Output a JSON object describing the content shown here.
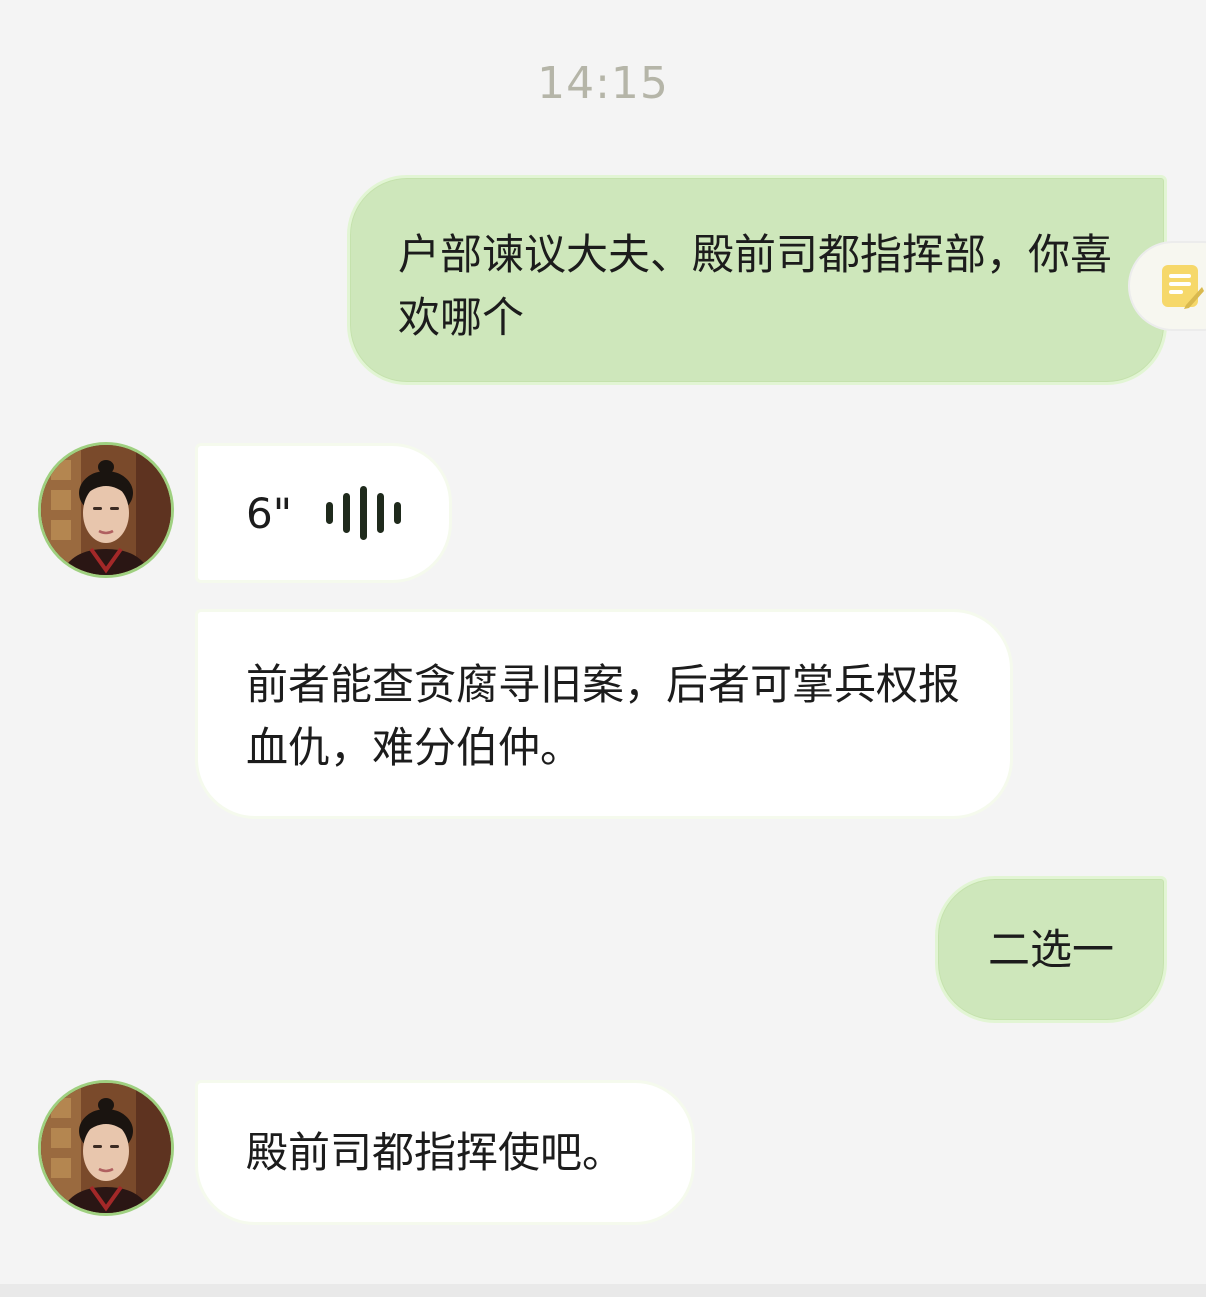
{
  "chat": {
    "timestamp": "14:15",
    "messages": [
      {
        "direction": "outgoing",
        "type": "text",
        "text": "户部谏议大夫、殿前司都指挥部，你喜欢哪个"
      },
      {
        "direction": "incoming",
        "type": "voice",
        "duration": "6\"",
        "icon": "sound-wave-icon"
      },
      {
        "direction": "incoming",
        "type": "text",
        "text": "前者能查贪腐寻旧案，后者可掌兵权报血仇，难分伯仲。"
      },
      {
        "direction": "outgoing",
        "type": "text",
        "text": "二选一"
      },
      {
        "direction": "incoming",
        "type": "text",
        "text": "殿前司都指挥使吧。"
      }
    ]
  },
  "colors": {
    "outgoing_bubble": "#cee7bb",
    "incoming_bubble": "#ffffff",
    "background": "#f4f4f4",
    "avatar_border": "#9fd080"
  },
  "icons": {
    "note": "note-edit-icon",
    "avatar": "character-avatar"
  }
}
